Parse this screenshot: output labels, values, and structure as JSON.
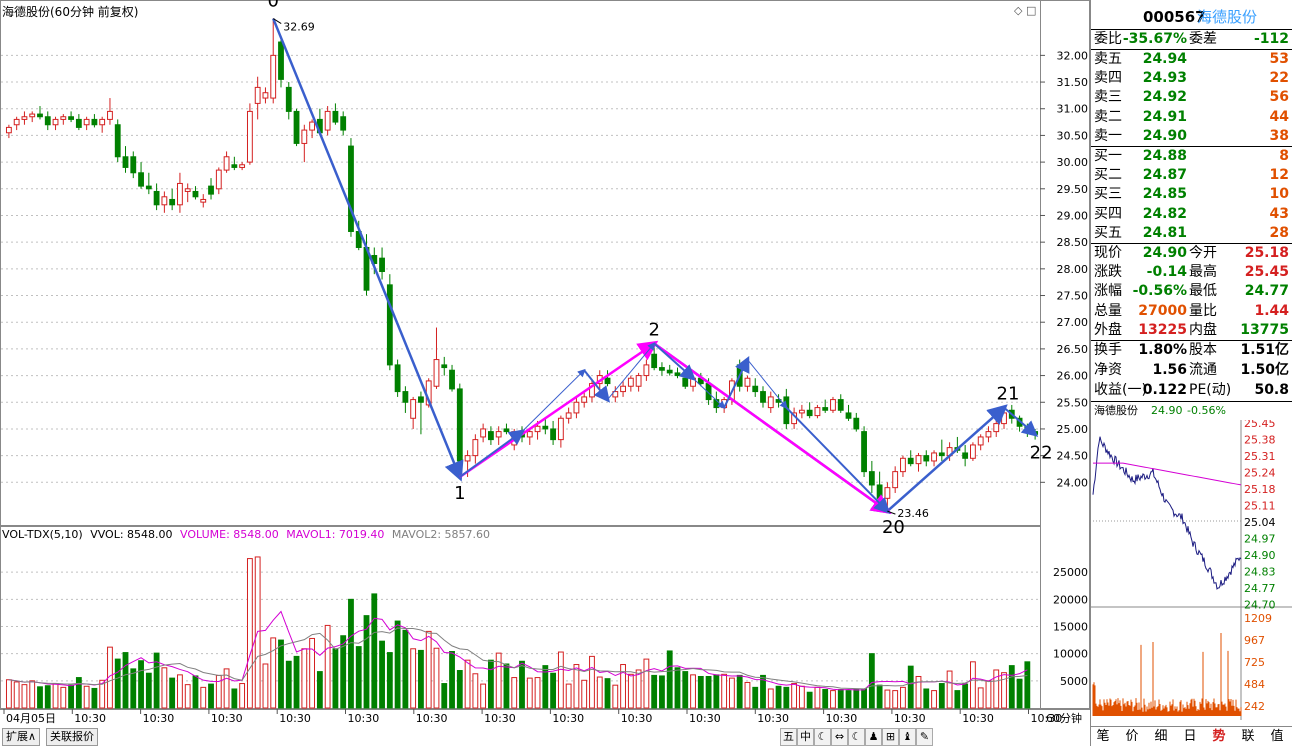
{
  "window": {
    "title": "海德股份(60分钟 前复权)"
  },
  "chart_data": {
    "type": "candlestick",
    "timeframe": "60分钟",
    "price_axis": {
      "ticks": [
        32.0,
        31.5,
        31.0,
        30.5,
        30.0,
        29.5,
        29.0,
        28.5,
        28.0,
        27.5,
        27.0,
        26.5,
        26.0,
        25.5,
        25.0,
        24.5,
        24.0
      ],
      "range": [
        23.2,
        33.0
      ]
    },
    "volume_axis": {
      "ticks": [
        25000,
        20000,
        15000,
        10000,
        5000
      ],
      "range": [
        0,
        30000
      ]
    },
    "x_labels": [
      "04月05日",
      "10:30",
      "10:30",
      "10:30",
      "10:30",
      "10:30",
      "10:30",
      "10:30",
      "10:30",
      "10:30",
      "10:30",
      "10:30",
      "10:30",
      "10:30",
      "10:30",
      "10:30"
    ],
    "period_label": "60分钟",
    "candles": [
      {
        "o": 30.55,
        "h": 30.7,
        "l": 30.45,
        "c": 30.65
      },
      {
        "o": 30.7,
        "h": 30.85,
        "l": 30.6,
        "c": 30.8
      },
      {
        "o": 30.8,
        "h": 30.95,
        "l": 30.7,
        "c": 30.85
      },
      {
        "o": 30.85,
        "h": 30.95,
        "l": 30.75,
        "c": 30.9
      },
      {
        "o": 30.9,
        "h": 31.05,
        "l": 30.8,
        "c": 30.85
      },
      {
        "o": 30.85,
        "h": 30.95,
        "l": 30.6,
        "c": 30.7
      },
      {
        "o": 30.7,
        "h": 30.85,
        "l": 30.6,
        "c": 30.8
      },
      {
        "o": 30.8,
        "h": 30.9,
        "l": 30.7,
        "c": 30.85
      },
      {
        "o": 30.85,
        "h": 30.95,
        "l": 30.75,
        "c": 30.8
      },
      {
        "o": 30.8,
        "h": 30.9,
        "l": 30.6,
        "c": 30.65
      },
      {
        "o": 30.7,
        "h": 30.85,
        "l": 30.6,
        "c": 30.8
      },
      {
        "o": 30.8,
        "h": 30.9,
        "l": 30.65,
        "c": 30.7
      },
      {
        "o": 30.7,
        "h": 30.85,
        "l": 30.55,
        "c": 30.8
      },
      {
        "o": 30.8,
        "h": 31.2,
        "l": 30.7,
        "c": 30.95
      },
      {
        "o": 30.7,
        "h": 30.8,
        "l": 30.0,
        "c": 30.1
      },
      {
        "o": 30.1,
        "h": 30.3,
        "l": 29.8,
        "c": 29.9
      },
      {
        "o": 30.1,
        "h": 30.2,
        "l": 29.7,
        "c": 29.8
      },
      {
        "o": 29.8,
        "h": 30.0,
        "l": 29.5,
        "c": 29.55
      },
      {
        "o": 29.55,
        "h": 29.8,
        "l": 29.4,
        "c": 29.5
      },
      {
        "o": 29.45,
        "h": 29.6,
        "l": 29.1,
        "c": 29.2
      },
      {
        "o": 29.2,
        "h": 29.45,
        "l": 29.05,
        "c": 29.35
      },
      {
        "o": 29.3,
        "h": 29.5,
        "l": 29.1,
        "c": 29.2
      },
      {
        "o": 29.2,
        "h": 29.8,
        "l": 29.05,
        "c": 29.6
      },
      {
        "o": 29.45,
        "h": 29.6,
        "l": 29.25,
        "c": 29.5
      },
      {
        "o": 29.45,
        "h": 29.55,
        "l": 29.3,
        "c": 29.35
      },
      {
        "o": 29.25,
        "h": 29.4,
        "l": 29.15,
        "c": 29.3
      },
      {
        "o": 29.55,
        "h": 29.7,
        "l": 29.3,
        "c": 29.4
      },
      {
        "o": 29.5,
        "h": 29.9,
        "l": 29.4,
        "c": 29.85
      },
      {
        "o": 29.85,
        "h": 30.2,
        "l": 29.8,
        "c": 30.1
      },
      {
        "o": 29.95,
        "h": 30.1,
        "l": 29.85,
        "c": 29.9
      },
      {
        "o": 29.9,
        "h": 30.0,
        "l": 29.85,
        "c": 29.95
      },
      {
        "o": 30.0,
        "h": 31.1,
        "l": 29.95,
        "c": 30.95
      },
      {
        "o": 31.1,
        "h": 31.6,
        "l": 30.8,
        "c": 31.4
      },
      {
        "o": 31.2,
        "h": 31.4,
        "l": 31.1,
        "c": 31.3
      },
      {
        "o": 31.2,
        "h": 32.69,
        "l": 31.1,
        "c": 32.0
      },
      {
        "o": 32.25,
        "h": 32.35,
        "l": 31.4,
        "c": 31.55
      },
      {
        "o": 31.4,
        "h": 31.5,
        "l": 30.8,
        "c": 30.95
      },
      {
        "o": 30.95,
        "h": 31.0,
        "l": 30.3,
        "c": 30.35
      },
      {
        "o": 30.35,
        "h": 30.7,
        "l": 30.0,
        "c": 30.6
      },
      {
        "o": 30.6,
        "h": 30.8,
        "l": 30.45,
        "c": 30.75
      },
      {
        "o": 30.8,
        "h": 31.0,
        "l": 30.5,
        "c": 30.55
      },
      {
        "o": 30.6,
        "h": 31.05,
        "l": 30.5,
        "c": 30.95
      },
      {
        "o": 30.95,
        "h": 31.1,
        "l": 30.7,
        "c": 30.75
      },
      {
        "o": 30.85,
        "h": 30.95,
        "l": 30.5,
        "c": 30.6
      },
      {
        "o": 30.3,
        "h": 30.45,
        "l": 28.6,
        "c": 28.7
      },
      {
        "o": 28.7,
        "h": 28.9,
        "l": 28.35,
        "c": 28.4
      },
      {
        "o": 28.4,
        "h": 28.65,
        "l": 27.5,
        "c": 27.6
      },
      {
        "o": 28.25,
        "h": 28.4,
        "l": 27.9,
        "c": 28.1
      },
      {
        "o": 28.2,
        "h": 28.4,
        "l": 27.8,
        "c": 27.95
      },
      {
        "o": 27.7,
        "h": 27.9,
        "l": 26.1,
        "c": 26.2
      },
      {
        "o": 26.2,
        "h": 26.3,
        "l": 25.6,
        "c": 25.7
      },
      {
        "o": 25.7,
        "h": 25.8,
        "l": 25.3,
        "c": 25.5
      },
      {
        "o": 25.2,
        "h": 25.6,
        "l": 25.0,
        "c": 25.55
      },
      {
        "o": 25.6,
        "h": 25.7,
        "l": 24.9,
        "c": 25.5
      },
      {
        "o": 25.45,
        "h": 25.95,
        "l": 25.4,
        "c": 25.9
      },
      {
        "o": 25.8,
        "h": 26.9,
        "l": 25.75,
        "c": 26.3
      },
      {
        "o": 26.2,
        "h": 26.35,
        "l": 26.0,
        "c": 26.15
      },
      {
        "o": 26.1,
        "h": 26.2,
        "l": 25.7,
        "c": 25.75
      },
      {
        "o": 25.75,
        "h": 25.85,
        "l": 24.3,
        "c": 24.4
      },
      {
        "o": 24.4,
        "h": 24.6,
        "l": 24.1,
        "c": 24.5
      },
      {
        "o": 24.5,
        "h": 24.9,
        "l": 24.35,
        "c": 24.8
      },
      {
        "o": 24.85,
        "h": 25.1,
        "l": 24.75,
        "c": 25.0
      },
      {
        "o": 24.95,
        "h": 25.05,
        "l": 24.7,
        "c": 24.8
      },
      {
        "o": 24.85,
        "h": 25.05,
        "l": 24.7,
        "c": 24.95
      },
      {
        "o": 25.0,
        "h": 25.1,
        "l": 24.9,
        "c": 24.95
      },
      {
        "o": 24.7,
        "h": 25.0,
        "l": 24.6,
        "c": 24.95
      },
      {
        "o": 24.95,
        "h": 25.05,
        "l": 24.75,
        "c": 24.85
      },
      {
        "o": 24.85,
        "h": 25.0,
        "l": 24.7,
        "c": 24.95
      },
      {
        "o": 24.95,
        "h": 25.15,
        "l": 24.8,
        "c": 25.05
      },
      {
        "o": 25.05,
        "h": 25.2,
        "l": 24.9,
        "c": 25.0
      },
      {
        "o": 25.0,
        "h": 25.15,
        "l": 24.7,
        "c": 24.8
      },
      {
        "o": 24.8,
        "h": 25.25,
        "l": 24.65,
        "c": 25.2
      },
      {
        "o": 25.2,
        "h": 25.4,
        "l": 25.1,
        "c": 25.3
      },
      {
        "o": 25.3,
        "h": 25.6,
        "l": 25.2,
        "c": 25.5
      },
      {
        "o": 25.5,
        "h": 25.7,
        "l": 25.4,
        "c": 25.6
      },
      {
        "o": 25.6,
        "h": 25.9,
        "l": 25.5,
        "c": 25.85
      },
      {
        "o": 25.85,
        "h": 26.1,
        "l": 25.75,
        "c": 26.0
      },
      {
        "o": 25.95,
        "h": 26.1,
        "l": 25.8,
        "c": 25.85
      },
      {
        "o": 25.6,
        "h": 25.8,
        "l": 25.5,
        "c": 25.7
      },
      {
        "o": 25.7,
        "h": 25.9,
        "l": 25.6,
        "c": 25.8
      },
      {
        "o": 25.8,
        "h": 26.0,
        "l": 25.7,
        "c": 25.95
      },
      {
        "o": 25.8,
        "h": 26.05,
        "l": 25.7,
        "c": 26.0
      },
      {
        "o": 26.0,
        "h": 26.3,
        "l": 25.9,
        "c": 26.2
      },
      {
        "o": 26.4,
        "h": 26.6,
        "l": 26.1,
        "c": 26.15
      },
      {
        "o": 26.15,
        "h": 26.25,
        "l": 26.0,
        "c": 26.1
      },
      {
        "o": 26.1,
        "h": 26.2,
        "l": 26.0,
        "c": 26.05
      },
      {
        "o": 26.05,
        "h": 26.15,
        "l": 25.95,
        "c": 26.0
      },
      {
        "o": 25.95,
        "h": 26.1,
        "l": 25.75,
        "c": 25.8
      },
      {
        "o": 25.8,
        "h": 26.0,
        "l": 25.7,
        "c": 25.95
      },
      {
        "o": 25.95,
        "h": 26.05,
        "l": 25.8,
        "c": 25.85
      },
      {
        "o": 25.85,
        "h": 25.95,
        "l": 25.45,
        "c": 25.55
      },
      {
        "o": 25.55,
        "h": 25.7,
        "l": 25.3,
        "c": 25.4
      },
      {
        "o": 25.4,
        "h": 25.6,
        "l": 25.3,
        "c": 25.55
      },
      {
        "o": 25.55,
        "h": 25.95,
        "l": 25.45,
        "c": 25.9
      },
      {
        "o": 26.2,
        "h": 26.3,
        "l": 25.7,
        "c": 25.8
      },
      {
        "o": 25.8,
        "h": 26.0,
        "l": 25.7,
        "c": 25.95
      },
      {
        "o": 25.8,
        "h": 25.95,
        "l": 25.6,
        "c": 25.7
      },
      {
        "o": 25.7,
        "h": 25.8,
        "l": 25.4,
        "c": 25.5
      },
      {
        "o": 25.4,
        "h": 25.7,
        "l": 25.3,
        "c": 25.6
      },
      {
        "o": 25.55,
        "h": 25.65,
        "l": 25.4,
        "c": 25.5
      },
      {
        "o": 25.6,
        "h": 25.75,
        "l": 25.0,
        "c": 25.1
      },
      {
        "o": 25.1,
        "h": 25.4,
        "l": 25.0,
        "c": 25.3
      },
      {
        "o": 25.3,
        "h": 25.45,
        "l": 25.2,
        "c": 25.35
      },
      {
        "o": 25.35,
        "h": 25.5,
        "l": 25.2,
        "c": 25.25
      },
      {
        "o": 25.25,
        "h": 25.45,
        "l": 25.2,
        "c": 25.4
      },
      {
        "o": 25.4,
        "h": 25.55,
        "l": 25.3,
        "c": 25.35
      },
      {
        "o": 25.35,
        "h": 25.6,
        "l": 25.3,
        "c": 25.55
      },
      {
        "o": 25.55,
        "h": 25.65,
        "l": 25.3,
        "c": 25.35
      },
      {
        "o": 25.3,
        "h": 25.45,
        "l": 25.15,
        "c": 25.2
      },
      {
        "o": 25.2,
        "h": 25.3,
        "l": 24.95,
        "c": 25.0
      },
      {
        "o": 24.95,
        "h": 25.05,
        "l": 24.1,
        "c": 24.2
      },
      {
        "o": 24.2,
        "h": 24.4,
        "l": 23.8,
        "c": 23.95
      },
      {
        "o": 23.95,
        "h": 24.2,
        "l": 23.6,
        "c": 23.7
      },
      {
        "o": 23.7,
        "h": 24.0,
        "l": 23.46,
        "c": 23.9
      },
      {
        "o": 23.9,
        "h": 24.3,
        "l": 23.8,
        "c": 24.2
      },
      {
        "o": 24.2,
        "h": 24.5,
        "l": 24.1,
        "c": 24.45
      },
      {
        "o": 24.45,
        "h": 24.6,
        "l": 24.3,
        "c": 24.35
      },
      {
        "o": 24.35,
        "h": 24.55,
        "l": 24.2,
        "c": 24.5
      },
      {
        "o": 24.5,
        "h": 24.6,
        "l": 24.3,
        "c": 24.4
      },
      {
        "o": 24.4,
        "h": 24.6,
        "l": 24.3,
        "c": 24.55
      },
      {
        "o": 24.55,
        "h": 24.8,
        "l": 24.4,
        "c": 24.5
      },
      {
        "o": 24.5,
        "h": 24.75,
        "l": 24.4,
        "c": 24.65
      },
      {
        "o": 24.65,
        "h": 24.85,
        "l": 24.55,
        "c": 24.6
      },
      {
        "o": 24.55,
        "h": 24.7,
        "l": 24.3,
        "c": 24.45
      },
      {
        "o": 24.45,
        "h": 24.75,
        "l": 24.4,
        "c": 24.7
      },
      {
        "o": 24.7,
        "h": 24.9,
        "l": 24.6,
        "c": 24.85
      },
      {
        "o": 24.85,
        "h": 25.05,
        "l": 24.75,
        "c": 24.95
      },
      {
        "o": 24.95,
        "h": 25.2,
        "l": 24.85,
        "c": 25.1
      },
      {
        "o": 25.1,
        "h": 25.4,
        "l": 25.0,
        "c": 25.3
      },
      {
        "o": 25.35,
        "h": 25.45,
        "l": 25.1,
        "c": 25.2
      },
      {
        "o": 25.2,
        "h": 25.25,
        "l": 24.95,
        "c": 25.05
      },
      {
        "o": 25.05,
        "h": 25.1,
        "l": 24.85,
        "c": 24.95
      },
      {
        "o": 24.95,
        "h": 25.0,
        "l": 24.8,
        "c": 24.9
      }
    ],
    "volumes": [
      5200,
      4800,
      4300,
      5000,
      3900,
      4100,
      4500,
      3800,
      4200,
      5600,
      4000,
      3600,
      5100,
      11200,
      9000,
      10200,
      7200,
      8700,
      6400,
      10100,
      7400,
      5500,
      6100,
      4300,
      5900,
      3800,
      4400,
      6000,
      7200,
      3500,
      4500,
      27500,
      27800,
      8100,
      12900,
      12500,
      8600,
      9500,
      10900,
      12800,
      6700,
      15200,
      10900,
      13300,
      20000,
      11300,
      17000,
      21000,
      12300,
      10200,
      16000,
      14300,
      10900,
      10600,
      14100,
      11000,
      4500,
      10400,
      6900,
      8800,
      6300,
      4400,
      8800,
      10100,
      8100,
      5600,
      8600,
      5500,
      5600,
      7800,
      6400,
      10300,
      4400,
      8000,
      5100,
      9500,
      5700,
      5400,
      4200,
      8000,
      6200,
      7000,
      9000,
      6000,
      5900,
      10500,
      7400,
      6700,
      6100,
      5800,
      5800,
      6100,
      6200,
      5500,
      6000,
      4700,
      3800,
      6000,
      3500,
      4000,
      3800,
      4500,
      4000,
      2900,
      3800,
      3400,
      3200,
      3400,
      3200,
      3400,
      3500,
      10000,
      4200,
      3300,
      3200,
      3800,
      7700,
      5800,
      3500,
      3200,
      4500,
      6800,
      3200,
      4400,
      8500,
      3700,
      5000,
      7000,
      6500,
      7800,
      5300,
      8500
    ],
    "pivots": [
      {
        "label": "0",
        "price": 32.69
      },
      {
        "label": "1",
        "price": 24.1
      },
      {
        "label": "2",
        "price": 26.6
      },
      {
        "label": "20",
        "price": 23.46
      },
      {
        "label": "21",
        "price": 25.4
      },
      {
        "label": "22",
        "price": 24.9
      }
    ],
    "price_annotations": [
      "32.69",
      "23.46"
    ],
    "volume_legend": {
      "name": "VOL-TDX(5,10)",
      "vvol": "VVOL: 8548.00",
      "volume": "VOLUME: 8548.00",
      "mavol1": "MAVOL1: 7019.40",
      "mavol2": "MAVOL2: 5857.60"
    },
    "colors": {
      "up": "#d42020",
      "down": "#008000",
      "arrow": "#3a5fcd",
      "wave": "#ff00ff",
      "mavol1": "#d400d4",
      "mavol2": "#808080"
    }
  },
  "right_panel": {
    "code": "000567",
    "name": "海德股份",
    "wei_bi_label": "委比",
    "wei_bi": "-35.67%",
    "wei_cha_label": "委差",
    "wei_cha": "-112",
    "asks": [
      {
        "label": "卖五",
        "price": "24.94",
        "vol": "53"
      },
      {
        "label": "卖四",
        "price": "24.93",
        "vol": "22"
      },
      {
        "label": "卖三",
        "price": "24.92",
        "vol": "56"
      },
      {
        "label": "卖二",
        "price": "24.91",
        "vol": "44"
      },
      {
        "label": "卖一",
        "price": "24.90",
        "vol": "38"
      }
    ],
    "bids": [
      {
        "label": "买一",
        "price": "24.88",
        "vol": "8"
      },
      {
        "label": "买二",
        "price": "24.87",
        "vol": "12"
      },
      {
        "label": "买三",
        "price": "24.85",
        "vol": "10"
      },
      {
        "label": "买四",
        "price": "24.82",
        "vol": "43"
      },
      {
        "label": "买五",
        "price": "24.81",
        "vol": "28"
      }
    ],
    "stats": [
      {
        "l1": "现价",
        "v1": "24.90",
        "l2": "今开",
        "v2": "25.18"
      },
      {
        "l1": "涨跌",
        "v1": "-0.14",
        "l2": "最高",
        "v2": "25.45"
      },
      {
        "l1": "涨幅",
        "v1": "-0.56%",
        "l2": "最低",
        "v2": "24.77"
      },
      {
        "l1": "总量",
        "v1": "27000",
        "l2": "量比",
        "v2": "1.44"
      },
      {
        "l1": "外盘",
        "v1": "13225",
        "l2": "内盘",
        "v2": "13775"
      }
    ],
    "stats2": [
      {
        "l1": "换手",
        "v1": "1.80%",
        "l2": "股本",
        "v2": "1.51亿"
      },
      {
        "l1": "净资",
        "v1": "1.56",
        "l2": "流通",
        "v2": "1.50亿"
      },
      {
        "l1": "收益(一)",
        "v1": "0.122",
        "l2": "PE(动)",
        "v2": "50.8"
      }
    ],
    "mini_chart": {
      "name": "海德股份",
      "price": "24.90",
      "change": "-0.56%",
      "price_ticks": [
        "25.45",
        "25.38",
        "25.31",
        "25.24",
        "25.18",
        "25.11",
        "25.04",
        "24.97",
        "24.90",
        "24.83",
        "24.77",
        "24.70"
      ],
      "vol_ticks": [
        "1209",
        "967",
        "725",
        "484",
        "242"
      ]
    },
    "tabs": [
      "笔",
      "价",
      "细",
      "日",
      "势",
      "联",
      "值"
    ],
    "active_tab": "势"
  },
  "bottom": {
    "btn1": "扩展∧",
    "btn2": "关联报价",
    "icons": [
      "五",
      "中",
      "☾",
      "⇔",
      "☾",
      "♟",
      "⊞",
      "♝",
      "✎"
    ]
  }
}
